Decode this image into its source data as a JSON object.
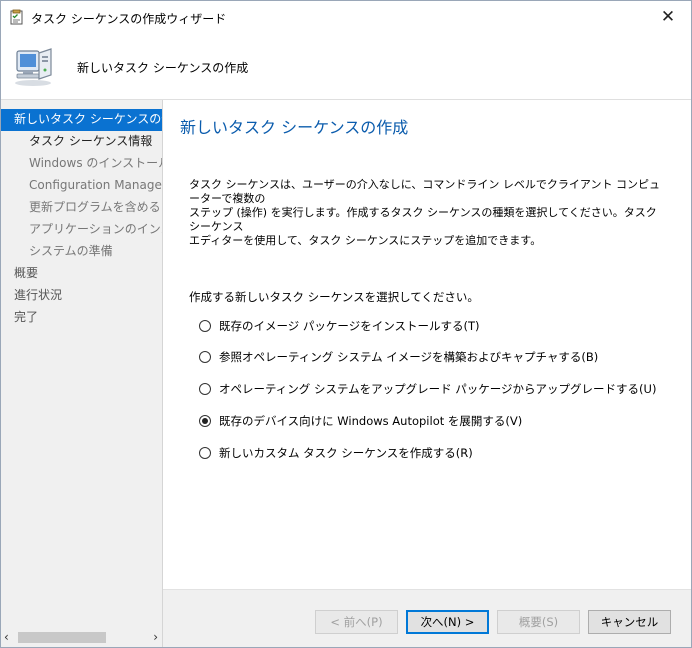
{
  "window": {
    "title": "タスク シーケンスの作成ウィザード",
    "close_glyph": "✕"
  },
  "header": {
    "title": "新しいタスク シーケンスの作成"
  },
  "nav": {
    "items": [
      {
        "label": "新しいタスク シーケンスの作成",
        "state": "active"
      },
      {
        "label": "タスク シーケンス情報",
        "state": "step-bold"
      },
      {
        "label": "Windows のインストール",
        "state": "step"
      },
      {
        "label": "Configuration Manager の",
        "state": "step"
      },
      {
        "label": "更新プログラムを含める",
        "state": "step"
      },
      {
        "label": "アプリケーションのインストール",
        "state": "step"
      },
      {
        "label": "システムの準備",
        "state": "step"
      },
      {
        "label": "概要",
        "state": "top"
      },
      {
        "label": "進行状況",
        "state": "top"
      },
      {
        "label": "完了",
        "state": "top"
      }
    ],
    "scroll_left": "‹",
    "scroll_right": "›"
  },
  "content": {
    "title": "新しいタスク シーケンスの作成",
    "description": "タスク シーケンスは、ユーザーの介入なしに、コマンドライン レベルでクライアント コンピューターで複数の\nステップ (操作) を実行します。作成するタスク シーケンスの種類を選択してください。タスク シーケンス\nエディターを使用して、タスク シーケンスにステップを追加できます。",
    "prompt": "作成する新しいタスク シーケンスを選択してください。",
    "options": [
      {
        "label": "既存のイメージ パッケージをインストールする(T)",
        "checked": false
      },
      {
        "label": "参照オペレーティング システム イメージを構築およびキャプチャする(B)",
        "checked": false
      },
      {
        "label": "オペレーティング システムをアップグレード パッケージからアップグレードする(U)",
        "checked": false
      },
      {
        "label": "既存のデバイス向けに Windows Autopilot を展開する(V)",
        "checked": true
      },
      {
        "label": "新しいカスタム タスク シーケンスを作成する(R)",
        "checked": false
      }
    ]
  },
  "footer": {
    "back": "< 前へ(P)",
    "next": "次へ(N) >",
    "summary": "概要(S)",
    "cancel": "キャンセル"
  },
  "colors": {
    "accent": "#0a72d1",
    "title_blue": "#0b5cad",
    "nav_bg": "#f0f0f0"
  }
}
